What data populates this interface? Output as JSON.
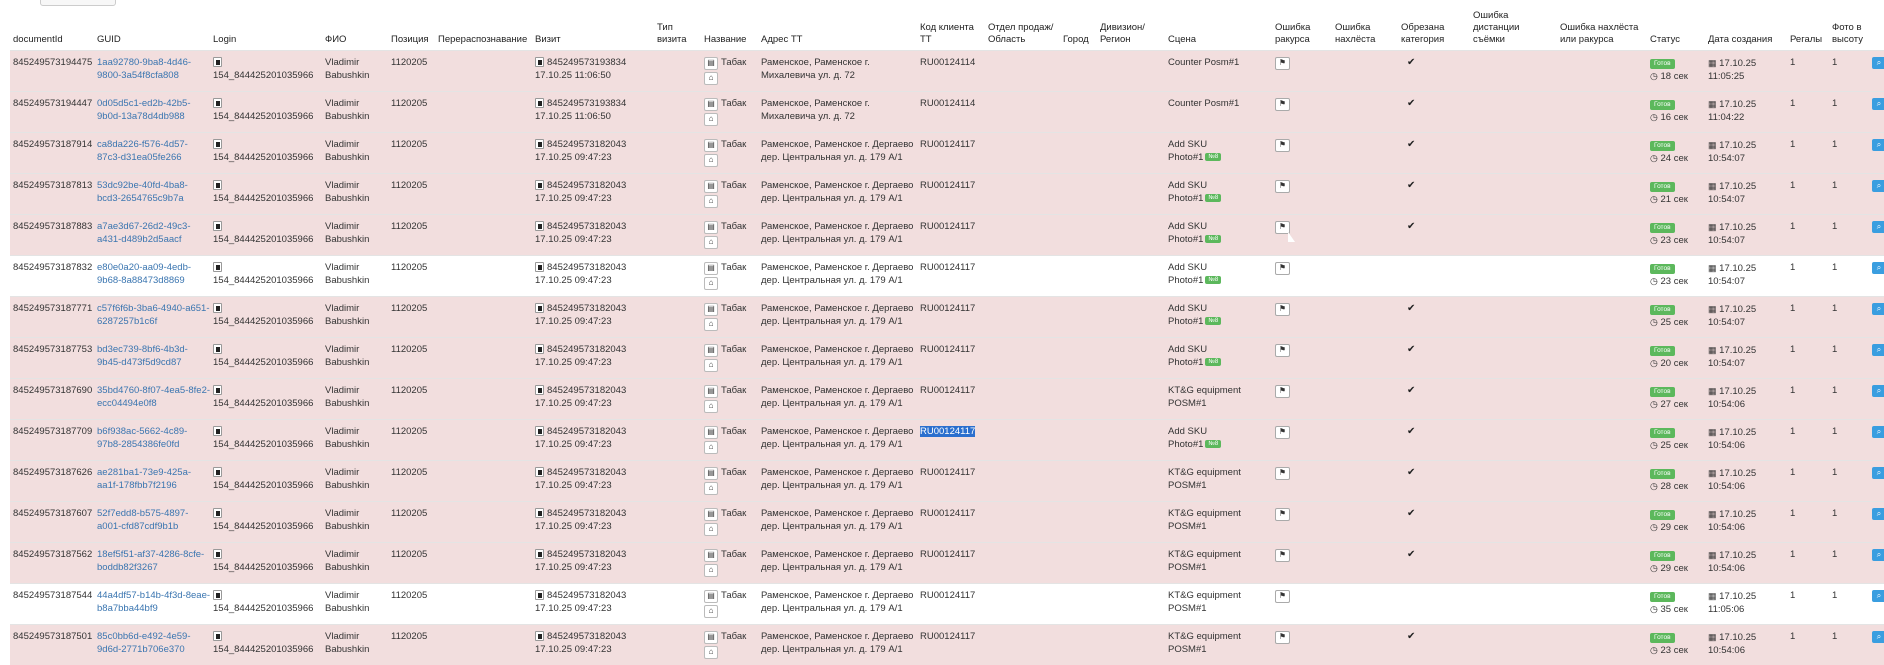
{
  "headers": [
    "documentId",
    "GUID",
    "Login",
    "ФИО",
    "Позиция",
    "Перераспознавание",
    "Визит",
    "Тип визита",
    "Название",
    "Адрес ТТ",
    "Код клиента ТТ",
    "Отдел продаж/ Область",
    "Город",
    "Дивизион/ Регион",
    "Сцена",
    "Ошибка ракурса",
    "Ошибка нахлёста",
    "Обрезана категория",
    "Ошибка дистанции съёмки",
    "Ошибка нахлёста или ракурса",
    "Статус",
    "Дата создания",
    "Регалы",
    "Фото в высоту"
  ],
  "status_label": "Готов",
  "tag_label": "№8",
  "rows": [
    {
      "doc": "845249573194475",
      "guid1": "1aa92780-9ba8-4d46-",
      "guid2": "9800-3a54f8cfa808",
      "login": "154_844425201035966",
      "fio1": "Vladimir",
      "fio2": "Babushkin",
      "pos": "1120205",
      "visit1": "845249573193834",
      "visit2": "17.10.25 11:06:50",
      "name": "Табак",
      "addr1": "Раменское, Раменское г.",
      "addr2": "Михалевича ул. д. 72",
      "code": "RU00124114",
      "scene1": "Counter Posm#1",
      "scene2": "",
      "tag": false,
      "crop": true,
      "time": "18 сек",
      "date1": "17.10.25",
      "date2": "11:05:25",
      "reg": "1",
      "photo": "1",
      "bg": "pink"
    },
    {
      "doc": "845249573194447",
      "guid1": "0d05d5c1-ed2b-42b5-",
      "guid2": "9b0d-13a78d4db988",
      "login": "154_844425201035966",
      "fio1": "Vladimir",
      "fio2": "Babushkin",
      "pos": "1120205",
      "visit1": "845249573193834",
      "visit2": "17.10.25 11:06:50",
      "name": "Табак",
      "addr1": "Раменское, Раменское г.",
      "addr2": "Михалевича ул. д. 72",
      "code": "RU00124114",
      "scene1": "Counter Posm#1",
      "scene2": "",
      "tag": false,
      "crop": true,
      "time": "16 сек",
      "date1": "17.10.25",
      "date2": "11:04:22",
      "reg": "1",
      "photo": "1",
      "bg": "pink"
    },
    {
      "doc": "845249573187914",
      "guid1": "ca8da226-f576-4d57-",
      "guid2": "87c3-d31ea05fe266",
      "login": "154_844425201035966",
      "fio1": "Vladimir",
      "fio2": "Babushkin",
      "pos": "1120205",
      "visit1": "845249573182043",
      "visit2": "17.10.25 09:47:23",
      "name": "Табак",
      "addr1": "Раменское, Раменское г. Дергаево",
      "addr2": "дер. Центральная ул. д. 179 А/1",
      "code": "RU00124117",
      "scene1": "Add SKU",
      "scene2": "Photo#1",
      "tag": true,
      "crop": true,
      "time": "24 сек",
      "date1": "17.10.25",
      "date2": "10:54:07",
      "reg": "1",
      "photo": "1",
      "bg": "pink"
    },
    {
      "doc": "845249573187813",
      "guid1": "53dc92be-40fd-4ba8-",
      "guid2": "bcd3-2654765c9b7a",
      "login": "154_844425201035966",
      "fio1": "Vladimir",
      "fio2": "Babushkin",
      "pos": "1120205",
      "visit1": "845249573182043",
      "visit2": "17.10.25 09:47:23",
      "name": "Табак",
      "addr1": "Раменское, Раменское г. Дергаево",
      "addr2": "дер. Центральная ул. д. 179 А/1",
      "code": "RU00124117",
      "scene1": "Add SKU",
      "scene2": "Photo#1",
      "tag": true,
      "crop": true,
      "time": "21 сек",
      "date1": "17.10.25",
      "date2": "10:54:07",
      "reg": "1",
      "photo": "1",
      "bg": "pink"
    },
    {
      "doc": "845249573187883",
      "guid1": "a7ae3d67-26d2-49c3-",
      "guid2": "a431-d489b2d5aacf",
      "login": "154_844425201035966",
      "fio1": "Vladimir",
      "fio2": "Babushkin",
      "pos": "1120205",
      "visit1": "845249573182043",
      "visit2": "17.10.25 09:47:23",
      "name": "Табак",
      "addr1": "Раменское, Раменское г. Дергаево",
      "addr2": "дер. Центральная ул. д. 179 А/1",
      "code": "RU00124117",
      "scene1": "Add SKU",
      "scene2": "Photo#1",
      "tag": true,
      "crop": true,
      "time": "23 сек",
      "date1": "17.10.25",
      "date2": "10:54:07",
      "reg": "1",
      "photo": "1",
      "bg": "pink"
    },
    {
      "doc": "845249573187832",
      "guid1": "e80e0a20-aa09-4edb-",
      "guid2": "9b68-8a88473d8869",
      "login": "154_844425201035966",
      "fio1": "Vladimir",
      "fio2": "Babushkin",
      "pos": "1120205",
      "visit1": "845249573182043",
      "visit2": "17.10.25 09:47:23",
      "name": "Табак",
      "addr1": "Раменское, Раменское г. Дергаево",
      "addr2": "дер. Центральная ул. д. 179 А/1",
      "code": "RU00124117",
      "scene1": "Add SKU",
      "scene2": "Photo#1",
      "tag": true,
      "crop": false,
      "time": "23 сек",
      "date1": "17.10.25",
      "date2": "10:54:07",
      "reg": "1",
      "photo": "1",
      "bg": "white"
    },
    {
      "doc": "845249573187771",
      "guid1": "c57f6f6b-3ba6-4940-a651-",
      "guid2": "6287257b1c6f",
      "login": "154_844425201035966",
      "fio1": "Vladimir",
      "fio2": "Babushkin",
      "pos": "1120205",
      "visit1": "845249573182043",
      "visit2": "17.10.25 09:47:23",
      "name": "Табак",
      "addr1": "Раменское, Раменское г. Дергаево",
      "addr2": "дер. Центральная ул. д. 179 А/1",
      "code": "RU00124117",
      "scene1": "Add SKU",
      "scene2": "Photo#1",
      "tag": true,
      "crop": true,
      "time": "25 сек",
      "date1": "17.10.25",
      "date2": "10:54:07",
      "reg": "1",
      "photo": "1",
      "bg": "pink"
    },
    {
      "doc": "845249573187753",
      "guid1": "bd3ec739-8bf6-4b3d-",
      "guid2": "9b45-d473f5d9cd87",
      "login": "154_844425201035966",
      "fio1": "Vladimir",
      "fio2": "Babushkin",
      "pos": "1120205",
      "visit1": "845249573182043",
      "visit2": "17.10.25 09:47:23",
      "name": "Табак",
      "addr1": "Раменское, Раменское г. Дергаево",
      "addr2": "дер. Центральная ул. д. 179 А/1",
      "code": "RU00124117",
      "scene1": "Add SKU",
      "scene2": "Photo#1",
      "tag": true,
      "crop": true,
      "time": "20 сек",
      "date1": "17.10.25",
      "date2": "10:54:07",
      "reg": "1",
      "photo": "1",
      "bg": "pink"
    },
    {
      "doc": "845249573187690",
      "guid1": "35bd4760-8f07-4ea5-8fe2-",
      "guid2": "ecc04494e0f8",
      "login": "154_844425201035966",
      "fio1": "Vladimir",
      "fio2": "Babushkin",
      "pos": "1120205",
      "visit1": "845249573182043",
      "visit2": "17.10.25 09:47:23",
      "name": "Табак",
      "addr1": "Раменское, Раменское г. Дергаево",
      "addr2": "дер. Центральная ул. д. 179 А/1",
      "code": "RU00124117",
      "scene1": "KT&G equipment",
      "scene2": "POSM#1",
      "tag": false,
      "crop": true,
      "time": "27 сек",
      "date1": "17.10.25",
      "date2": "10:54:06",
      "reg": "1",
      "photo": "1",
      "bg": "pink"
    },
    {
      "doc": "845249573187709",
      "guid1": "b6f938ac-5662-4c89-",
      "guid2": "97b8-2854386fe0fd",
      "login": "154_844425201035966",
      "fio1": "Vladimir",
      "fio2": "Babushkin",
      "pos": "1120205",
      "visit1": "845249573182043",
      "visit2": "17.10.25 09:47:23",
      "name": "Табак",
      "addr1": "Раменское, Раменское г. Дергаево",
      "addr2": "дер. Центральная ул. д. 179 А/1",
      "code": "RU00124117",
      "scene1": "Add SKU",
      "scene2": "Photo#1",
      "tag": true,
      "crop": true,
      "time": "25 сек",
      "date1": "17.10.25",
      "date2": "10:54:06",
      "reg": "1",
      "photo": "1",
      "bg": "pink",
      "highlight": true
    },
    {
      "doc": "845249573187626",
      "guid1": "ae281ba1-73e9-425a-",
      "guid2": "aa1f-178fbb7f2196",
      "login": "154_844425201035966",
      "fio1": "Vladimir",
      "fio2": "Babushkin",
      "pos": "1120205",
      "visit1": "845249573182043",
      "visit2": "17.10.25 09:47:23",
      "name": "Табак",
      "addr1": "Раменское, Раменское г. Дергаево",
      "addr2": "дер. Центральная ул. д. 179 А/1",
      "code": "RU00124117",
      "scene1": "KT&G equipment",
      "scene2": "POSM#1",
      "tag": false,
      "crop": true,
      "time": "28 сек",
      "date1": "17.10.25",
      "date2": "10:54:06",
      "reg": "1",
      "photo": "1",
      "bg": "pink"
    },
    {
      "doc": "845249573187607",
      "guid1": "52f7edd8-b575-4897-",
      "guid2": "a001-cfd87cdf9b1b",
      "login": "154_844425201035966",
      "fio1": "Vladimir",
      "fio2": "Babushkin",
      "pos": "1120205",
      "visit1": "845249573182043",
      "visit2": "17.10.25 09:47:23",
      "name": "Табак",
      "addr1": "Раменское, Раменское г. Дергаево",
      "addr2": "дер. Центральная ул. д. 179 А/1",
      "code": "RU00124117",
      "scene1": "KT&G equipment",
      "scene2": "POSM#1",
      "tag": false,
      "crop": true,
      "time": "29 сек",
      "date1": "17.10.25",
      "date2": "10:54:06",
      "reg": "1",
      "photo": "1",
      "bg": "pink"
    },
    {
      "doc": "845249573187562",
      "guid1": "18ef5f51-af37-4286-8cfe-",
      "guid2": "boddb82f3267",
      "login": "154_844425201035966",
      "fio1": "Vladimir",
      "fio2": "Babushkin",
      "pos": "1120205",
      "visit1": "845249573182043",
      "visit2": "17.10.25 09:47:23",
      "name": "Табак",
      "addr1": "Раменское, Раменское г. Дергаево",
      "addr2": "дер. Центральная ул. д. 179 А/1",
      "code": "RU00124117",
      "scene1": "KT&G equipment",
      "scene2": "POSM#1",
      "tag": false,
      "crop": true,
      "time": "29 сек",
      "date1": "17.10.25",
      "date2": "10:54:06",
      "reg": "1",
      "photo": "1",
      "bg": "pink"
    },
    {
      "doc": "845249573187544",
      "guid1": "44a4df57-b14b-4f3d-8eae-",
      "guid2": "b8a7bba44bf9",
      "login": "154_844425201035966",
      "fio1": "Vladimir",
      "fio2": "Babushkin",
      "pos": "1120205",
      "visit1": "845249573182043",
      "visit2": "17.10.25 09:47:23",
      "name": "Табак",
      "addr1": "Раменское, Раменское г. Дергаево",
      "addr2": "дер. Центральная ул. д. 179 А/1",
      "code": "RU00124117",
      "scene1": "KT&G equipment",
      "scene2": "POSM#1",
      "tag": false,
      "crop": false,
      "time": "35 сек",
      "date1": "17.10.25",
      "date2": "11:05:06",
      "reg": "1",
      "photo": "1",
      "bg": "white"
    },
    {
      "doc": "845249573187501",
      "guid1": "85c0bb6d-e492-4e59-",
      "guid2": "9d6d-2771b706e370",
      "login": "154_844425201035966",
      "fio1": "Vladimir",
      "fio2": "Babushkin",
      "pos": "1120205",
      "visit1": "845249573182043",
      "visit2": "17.10.25 09:47:23",
      "name": "Табак",
      "addr1": "Раменское, Раменское г. Дергаево",
      "addr2": "дер. Центральная ул. д. 179 А/1",
      "code": "RU00124117",
      "scene1": "KT&G equipment",
      "scene2": "POSM#1",
      "tag": false,
      "crop": true,
      "time": "23 сек",
      "date1": "17.10.25",
      "date2": "10:54:06",
      "reg": "1",
      "photo": "1",
      "bg": "pink"
    }
  ]
}
